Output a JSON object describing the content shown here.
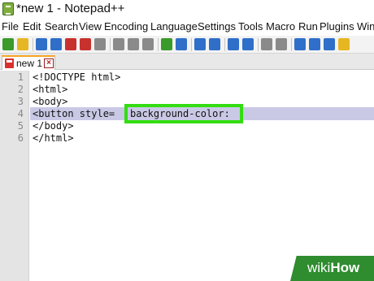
{
  "window": {
    "title": "*new 1 - Notepad++"
  },
  "menu": [
    "File",
    "Edit",
    "Search",
    "View",
    "Encoding",
    "Language",
    "Settings",
    "Tools",
    "Macro",
    "Run",
    "Plugins",
    "Win"
  ],
  "toolbar": {
    "icons": [
      "new-file-icon",
      "open-file-icon",
      "save-icon",
      "save-all-icon",
      "close-icon",
      "close-all-icon",
      "print-icon",
      "cut-icon",
      "copy-icon",
      "paste-icon",
      "undo-icon",
      "redo-icon",
      "find-icon",
      "replace-icon",
      "zoom-in-icon",
      "zoom-out-icon",
      "sync-vertical-icon",
      "sync-horizontal-icon",
      "word-wrap-icon",
      "show-all-characters-icon",
      "indent-guide-icon",
      "user-language-icon"
    ],
    "colors": {
      "green": "#3a9a2a",
      "blue": "#2f6fc9",
      "red": "#c8322e",
      "yellow": "#e7b623",
      "gray": "#8a8a8a"
    }
  },
  "tabs": [
    {
      "label": "new 1",
      "active": true,
      "modified": true
    }
  ],
  "editor": {
    "line_numbers": [
      "1",
      "2",
      "3",
      "4",
      "5",
      "6"
    ],
    "lines": [
      "<!DOCTYPE html>",
      "<html>",
      "<body>",
      "<button style=",
      "</body>",
      "</html>"
    ],
    "highlighted_text": "background-color:",
    "current_line": 4,
    "current_line_color": "#c9c9e6",
    "callout_color": "#33dd11"
  },
  "watermark": {
    "prefix": "wiki",
    "suffix": "How",
    "color": "#2f8c2f"
  }
}
